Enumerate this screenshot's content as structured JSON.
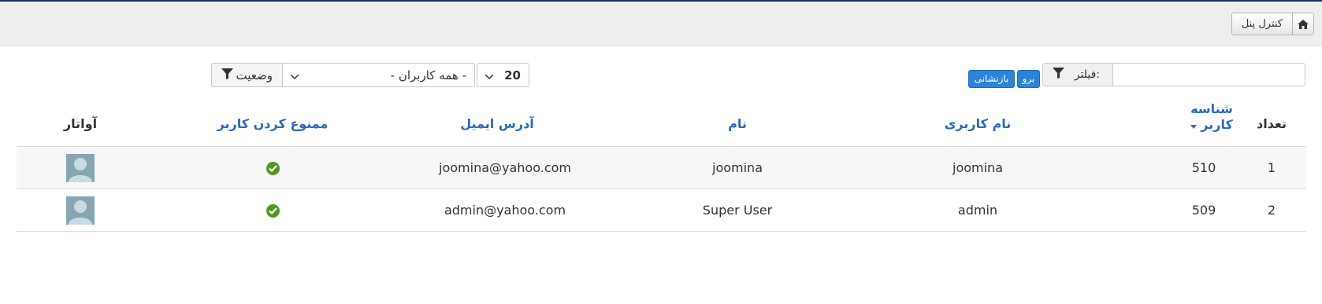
{
  "toolbar": {
    "control_panel_label": "کنترل پنل"
  },
  "filters": {
    "search_placeholder": "",
    "search_value": "",
    "filter_label": "فیلتر:",
    "go_label": "برو",
    "reset_label": "بازنشانی",
    "limit_value": "20",
    "users_select_value": "- همه کاربران -",
    "state_label": "وضعیت"
  },
  "table": {
    "headers": {
      "count": "تعداد",
      "user_id_line1": "شناسه",
      "user_id_line2": "کاربر",
      "username": "نام کاربری",
      "name": "نام",
      "email": "آدرس ایمیل",
      "blocked": "ممنوع کردن کاربر",
      "avatar": "آواتار"
    },
    "sort": {
      "column": "user_id",
      "direction": "descending"
    },
    "rows": [
      {
        "count": "1",
        "user_id": "510",
        "username": "joomina",
        "name": "joomina",
        "email": "joomina@yahoo.com",
        "blocked_icon": "check-icon"
      },
      {
        "count": "2",
        "user_id": "509",
        "username": "admin",
        "name": "Super User",
        "email": "admin@yahoo.com",
        "blocked_icon": "check-icon"
      }
    ]
  },
  "colors": {
    "link_blue": "#2a69b8",
    "button_blue": "#2c84d6",
    "check_green": "#4f9a1d",
    "top_bar": "#1d2d5a"
  }
}
